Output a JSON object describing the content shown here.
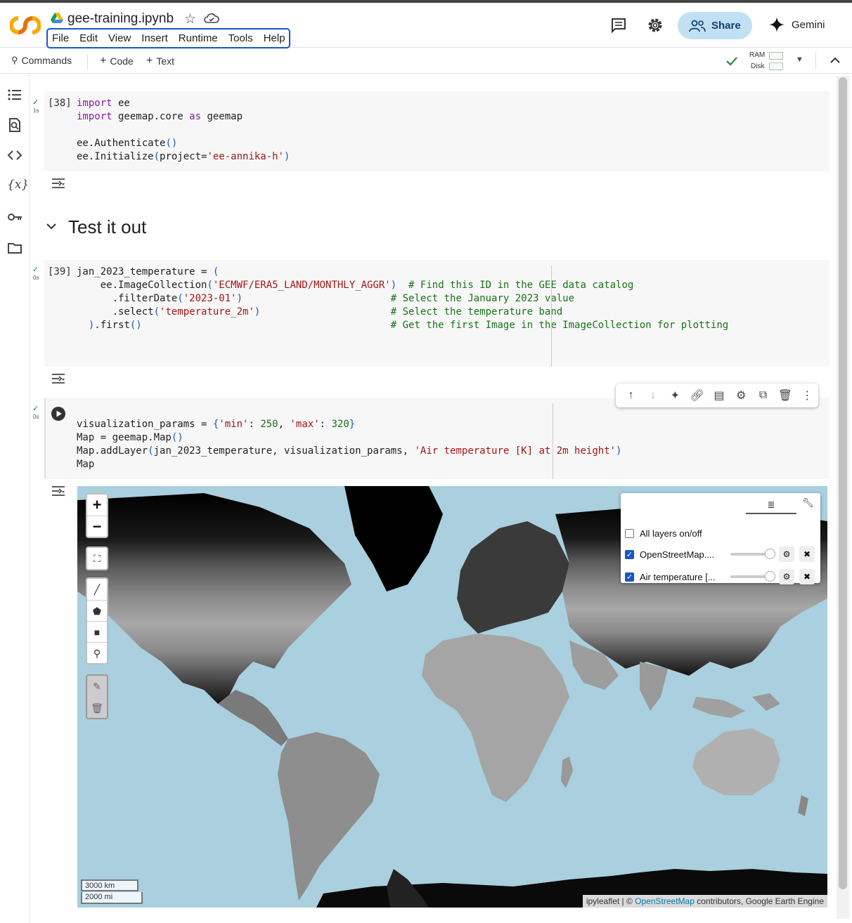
{
  "notebook": {
    "filename": "gee-training.ipynb"
  },
  "menu": [
    "File",
    "Edit",
    "View",
    "Insert",
    "Runtime",
    "Tools",
    "Help"
  ],
  "header": {
    "share_label": "Share",
    "gemini_label": "Gemini"
  },
  "toolbar": {
    "commands": "Commands",
    "code": "Code",
    "text": "Text",
    "ram": "RAM",
    "disk": "Disk"
  },
  "cells": {
    "c1": {
      "exec": "[38]",
      "time": "1s"
    },
    "section": {
      "title": "Test it out"
    },
    "c2": {
      "exec": "[39]",
      "time": "0s"
    },
    "c3": {
      "time": "0s"
    }
  },
  "map": {
    "scale_km": "3000 km",
    "scale_mi": "2000 mi",
    "attribution_prefix": "ipyleaflet | © ",
    "attribution_link": "OpenStreetMap",
    "attribution_suffix": " contributors, Google Earth Engine",
    "layers": {
      "all": "All layers on/off",
      "items": [
        "OpenStreetMap....",
        "Air temperature [..."
      ],
      "all_checked": false,
      "items_checked": [
        true,
        true
      ],
      "opacity": [
        1,
        1
      ]
    }
  },
  "colors": {
    "accent": "#1a56c4",
    "share_bg": "#c2e0f4",
    "ocean": "#aacfdf"
  }
}
